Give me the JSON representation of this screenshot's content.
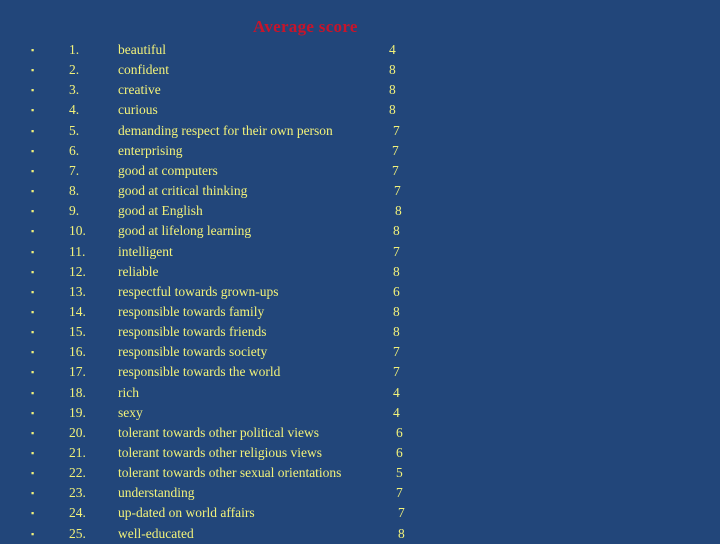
{
  "title": "Average score",
  "colors": {
    "background": "#22467a",
    "text": "#f2f27a",
    "title": "#c8142a"
  },
  "items": [
    {
      "num": "1.",
      "label": "beautiful",
      "score": "4"
    },
    {
      "num": "2.",
      "label": "confident",
      "score": "8"
    },
    {
      "num": "3.",
      "label": "creative",
      "score": "8"
    },
    {
      "num": "4.",
      "label": "curious",
      "score": "8"
    },
    {
      "num": "5.",
      "label": "demanding respect for their own person",
      "score": "7"
    },
    {
      "num": "6.",
      "label": "enterprising",
      "score": "7"
    },
    {
      "num": "7.",
      "label": "good at computers",
      "score": "7"
    },
    {
      "num": "8.",
      "label": "good at critical thinking",
      "score": "7"
    },
    {
      "num": "9.",
      "label": "good at English",
      "score": "8"
    },
    {
      "num": "10.",
      "label": "good at lifelong learning",
      "score": "8"
    },
    {
      "num": "11.",
      "label": "intelligent",
      "score": "7"
    },
    {
      "num": "12.",
      "label": "reliable",
      "score": "8"
    },
    {
      "num": "13.",
      "label": "respectful towards grown-ups",
      "score": "6"
    },
    {
      "num": "14.",
      "label": "responsible towards family",
      "score": "8"
    },
    {
      "num": "15.",
      "label": "responsible towards friends",
      "score": "8"
    },
    {
      "num": "16.",
      "label": "responsible towards society",
      "score": "7"
    },
    {
      "num": "17.",
      "label": "responsible towards the world",
      "score": "7"
    },
    {
      "num": "18.",
      "label": "rich",
      "score": "4"
    },
    {
      "num": "19.",
      "label": "sexy",
      "score": "4"
    },
    {
      "num": "20.",
      "label": "tolerant towards other political views",
      "score": "6"
    },
    {
      "num": "21.",
      "label": "tolerant towards other religious views",
      "score": "6"
    },
    {
      "num": "22.",
      "label": "tolerant towards other sexual orientations",
      "score": "5"
    },
    {
      "num": "23.",
      "label": "understanding",
      "score": "7"
    },
    {
      "num": "24.",
      "label": "up-dated on world affairs",
      "score": "7"
    },
    {
      "num": "25.",
      "label": "well-educated",
      "score": "8"
    }
  ]
}
